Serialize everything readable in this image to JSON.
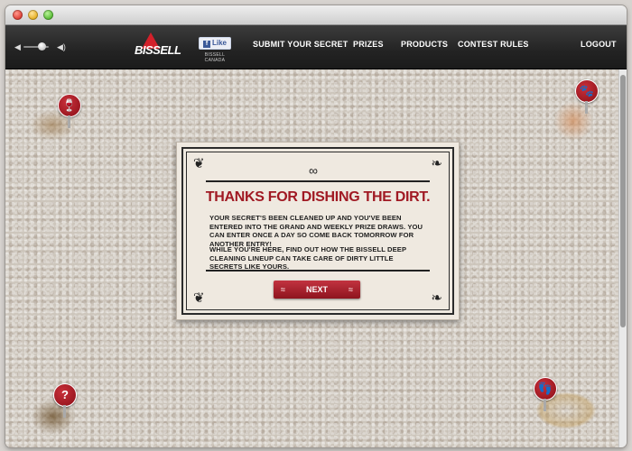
{
  "nav": {
    "brand": "BISSELL",
    "facebook_like": "Like",
    "facebook_caption": "BISSELL CANADA",
    "links": [
      "SUBMIT YOUR SECRET",
      "PRIZES",
      "PRODUCTS",
      "CONTEST RULES"
    ],
    "logout": "LOGOUT",
    "volume_level": 0.7
  },
  "modal": {
    "heading": "THANKS FOR DISHING THE DIRT.",
    "paragraph1": "YOUR SECRET'S BEEN CLEANED UP AND YOU'VE BEEN ENTERED INTO THE GRAND AND WEEKLY PRIZE DRAWS. YOU CAN ENTER ONCE A DAY SO COME BACK TOMORROW FOR ANOTHER ENTRY!",
    "paragraph2": "WHILE YOU'RE HERE, FIND OUT HOW THE BISSELL DEEP CLEANING LINEUP CAN TAKE CARE OF DIRTY LITTLE SECRETS LIKE YOURS.",
    "next_button": "NEXT"
  },
  "pins": [
    {
      "icon": "wine-glass-icon",
      "symbol": "🍷"
    },
    {
      "icon": "paw-print-icon",
      "symbol": "🐾"
    },
    {
      "icon": "question-mark-icon",
      "symbol": "?"
    },
    {
      "icon": "footprints-icon",
      "symbol": "👣"
    }
  ],
  "colors": {
    "brand_red": "#a01923",
    "nav_bg": "#232323",
    "modal_bg": "#efe9e0"
  }
}
